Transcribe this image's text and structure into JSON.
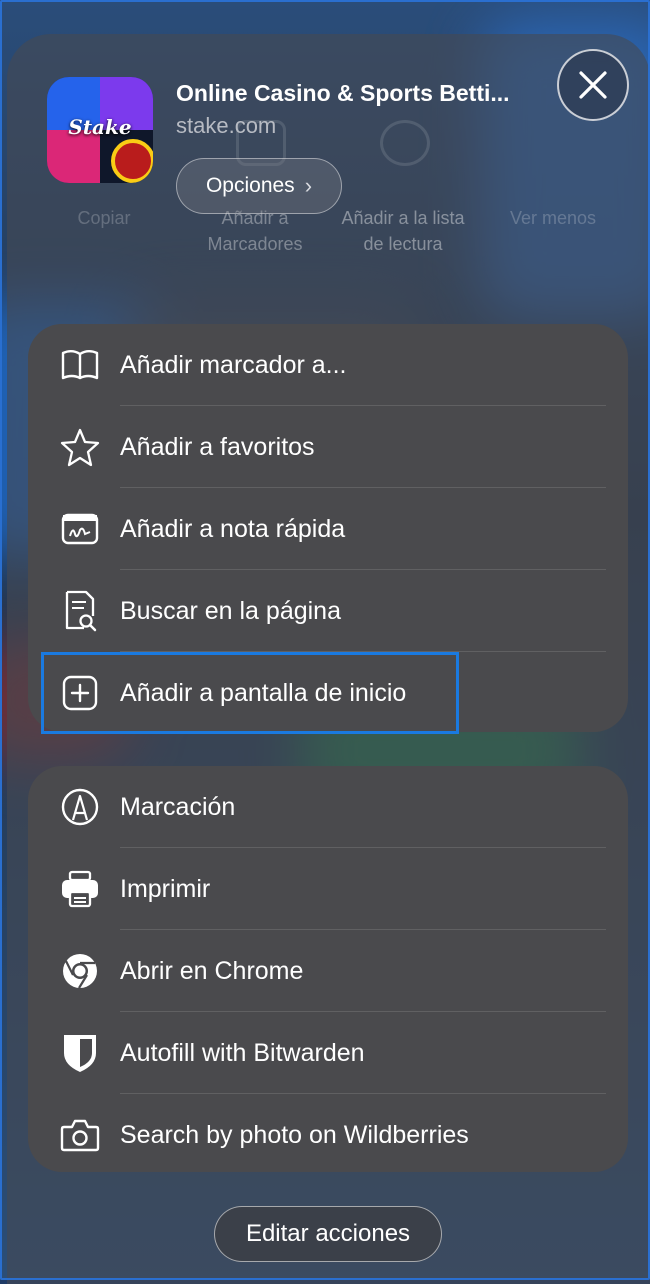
{
  "header": {
    "title": "Online Casino & Sports Betti...",
    "domain": "stake.com",
    "options_label": "Opciones",
    "app_icon_text": "Stake"
  },
  "background_actions": [
    {
      "label": "Copiar"
    },
    {
      "label": "Añadir a Marcadores"
    },
    {
      "label": "Añadir a la lista de lectura"
    },
    {
      "label": "Ver menos"
    }
  ],
  "group1": [
    {
      "label": "Añadir marcador a...",
      "icon": "book-icon"
    },
    {
      "label": "Añadir a favoritos",
      "icon": "star-icon"
    },
    {
      "label": "Añadir a nota rápida",
      "icon": "quick-note-icon"
    },
    {
      "label": "Buscar en la página",
      "icon": "find-in-page-icon"
    },
    {
      "label": "Añadir a pantalla de inicio",
      "icon": "add-square-icon"
    }
  ],
  "group2": [
    {
      "label": "Marcación",
      "icon": "markup-icon"
    },
    {
      "label": "Imprimir",
      "icon": "printer-icon"
    },
    {
      "label": "Abrir en Chrome",
      "icon": "chrome-icon"
    },
    {
      "label": "Autofill with Bitwarden",
      "icon": "bitwarden-shield-icon"
    },
    {
      "label": "Search by photo on Wildberries",
      "icon": "camera-icon"
    }
  ],
  "footer": {
    "edit_label": "Editar acciones"
  },
  "colors": {
    "highlight": "#1a7ae0",
    "panel": "#4a4a4d"
  }
}
